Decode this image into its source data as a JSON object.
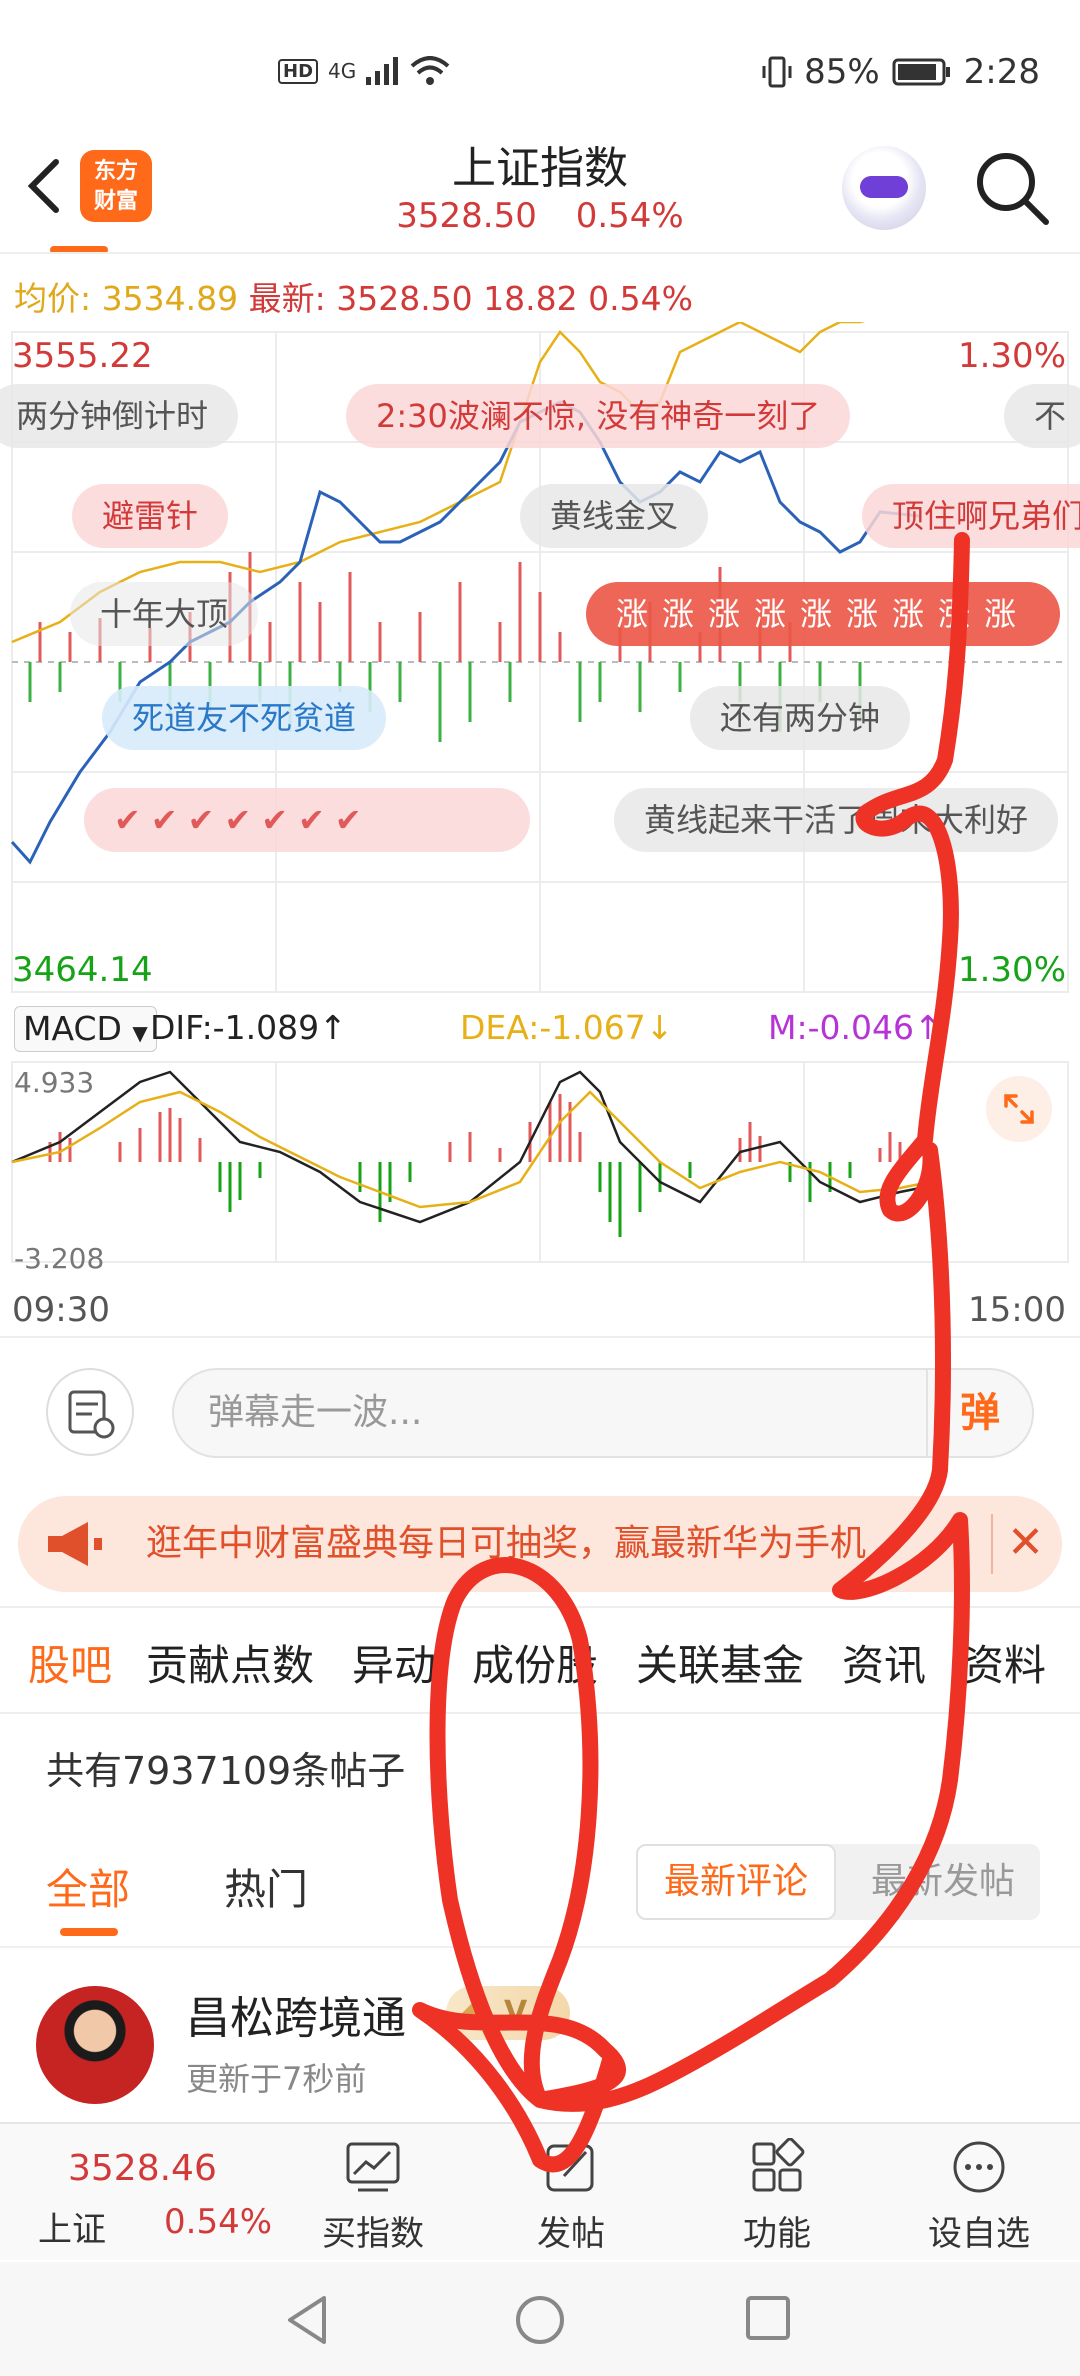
{
  "status_bar": {
    "network": "4G",
    "hd_label": "HD",
    "battery": "85%",
    "time": "2:28"
  },
  "header": {
    "back_icon": "chevron-left-icon",
    "logo_line1": "东方",
    "logo_line2": "财富",
    "title": "上证指数",
    "price": "3528.50",
    "change_pct": "0.54%"
  },
  "price_info": {
    "avg_label": "均价:",
    "avg_value": "3534.89",
    "latest_label": "最新:",
    "latest_value": "3528.50",
    "change": "18.82",
    "change_pct": "0.54%"
  },
  "chart_axis": {
    "high": "3555.22",
    "high_pct": "1.30%",
    "low": "3464.14",
    "low_pct": "1.30%",
    "time_start": "09:30",
    "time_end": "15:00"
  },
  "danmaku": {
    "d1": "两分钟倒计时",
    "d2": "2:30波澜不惊,  没有神奇一刻了",
    "d3": "不",
    "d4": "避雷针",
    "d5": "黄线金叉",
    "d6": "顶住啊兄弟们",
    "d7": "十年大顶",
    "d8": "涨涨涨涨涨涨涨涨涨",
    "d9": "死道友不死贫道",
    "d10": "还有两分钟",
    "d11": "黄线起来干活了周末大利好"
  },
  "macd": {
    "selector": "MACD",
    "dif": "DIF:-1.089↑",
    "dea": "DEA:-1.067↓",
    "m": "M:-0.046↑",
    "top": "4.933",
    "bottom": "-3.208"
  },
  "comment": {
    "placeholder": "弹幕走一波...",
    "danmaku_button": "弹"
  },
  "notice": {
    "text": "逛年中财富盛典每日可抽奖，赢最新华为手机",
    "close": "✕"
  },
  "tabs": [
    "股吧",
    "贡献点数",
    "异动",
    "成份股",
    "关联基金",
    "资讯",
    "资料"
  ],
  "posts_header": {
    "count_text": "共有7937109条帖子"
  },
  "subtabs": {
    "all": "全部",
    "hot": "热门",
    "latest_comment": "最新评论",
    "latest_post": "最新发帖"
  },
  "post": {
    "username": "昌松跨境通",
    "badge": "V",
    "updated": "更新于7秒前"
  },
  "bottom_bar": {
    "price": "3528.46",
    "name": "上证",
    "pct": "0.54%",
    "buy_index": "买指数",
    "post": "发帖",
    "functions": "功能",
    "watchlist": "设自选"
  },
  "colors": {
    "brand": "#ff6a1a",
    "up": "#d23a3a",
    "down": "#17a317",
    "avg_line": "#e6b016",
    "price_line": "#2a62b8"
  }
}
